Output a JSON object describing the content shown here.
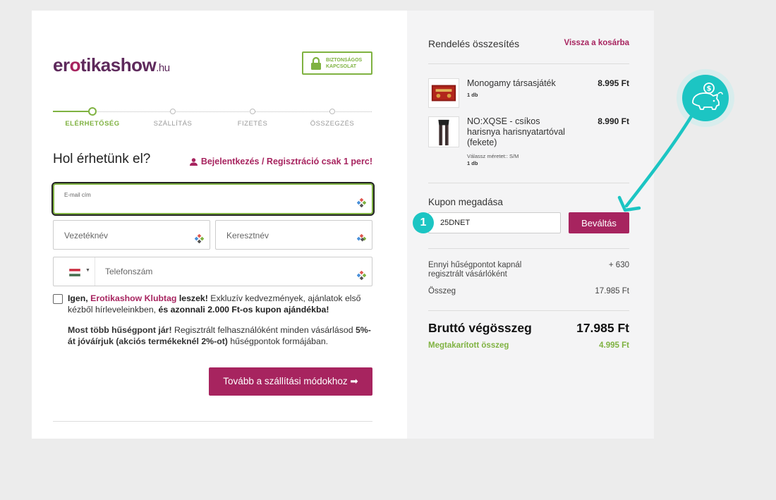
{
  "logo": {
    "part1": "er",
    "part2": "o",
    "part3": "tikashow",
    "tld": ".hu"
  },
  "secure": {
    "line1": "BIZTONSÁGOS",
    "line2": "KAPCSOLAT"
  },
  "steps": [
    "ELÉRHETŐSÉG",
    "SZÁLLÍTÁS",
    "FIZETÉS",
    "ÖSSZEGZÉS"
  ],
  "form": {
    "heading": "Hol érhetünk el?",
    "login_link": "Bejelentkezés / Regisztráció csak 1 perc!",
    "email_label": "E-mail cím",
    "lastname_placeholder": "Vezetéknév",
    "firstname_placeholder": "Keresztnév",
    "phone_placeholder": "Telefonszám",
    "consent_1": "Igen, ",
    "consent_brand": "Erotikashow Klubtag",
    "consent_2": " leszek!",
    "consent_3": " Exkluzív kedvezmények, ajánlatok első kézből hírleveleinkben, ",
    "consent_4": "és azonnali 2.000 Ft-os kupon ajándékba!",
    "points_1": "Most több hűségpont jár!",
    "points_2": " Regisztrált felhasználóként minden vásárlásod ",
    "points_3": "5%-át jóváírjuk (akciós termékeknél 2%-ot)",
    "points_4": " hűségpontok formájában.",
    "next_button": "Tovább a szállítási módokhoz ➡"
  },
  "summary": {
    "title": "Rendelés összesítés",
    "back_link": "Vissza a kosárba",
    "items": [
      {
        "name": "Monogamy társasjáték",
        "qty": "1 db",
        "price": "8.995 Ft"
      },
      {
        "name": "NO:XQSE - csíkos harisnya harisnyatartóval (fekete)",
        "size": "Válassz méretet:: S/M",
        "qty": "1 db",
        "price": "8.990 Ft"
      }
    ],
    "coupon_title": "Kupon megadása",
    "coupon_value": "25DNET",
    "coupon_badge": "1",
    "redeem_button": "Beváltás",
    "points_label": "Ennyi hűségpontot kapnál regisztrált vásárlóként",
    "points_value": "+ 630",
    "sum_label": "Összeg",
    "sum_value": "17.985 Ft",
    "total_label": "Bruttó végösszeg",
    "total_value": "17.985 Ft",
    "saved_label": "Megtakarított összeg",
    "saved_value": "4.995 Ft"
  },
  "colors": {
    "brand": "#a7245f",
    "green": "#7fb241",
    "teal": "#1cc5c3",
    "logo": "#5e2a5c"
  },
  "icons": {
    "secure": "lock-icon",
    "login": "user-icon",
    "promo": "piggy-bank-coin-icon",
    "callout": "curved-arrow-icon"
  }
}
